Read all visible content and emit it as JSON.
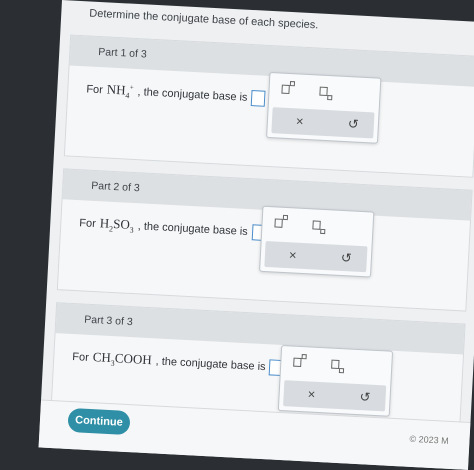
{
  "prompt": "Determine the conjugate base of each species.",
  "parts": [
    {
      "header": "Part 1 of 3",
      "pre": "For ",
      "species_main": "NH",
      "species_sub": "4",
      "species_sup": "+",
      "species_tail": "",
      "post": ", the conjugate base is",
      "end": "."
    },
    {
      "header": "Part 2 of 3",
      "pre": "For ",
      "species_main": "H",
      "species_sub": "2",
      "species_sup": "",
      "species_tail": "SO",
      "species_sub2": "3",
      "post": ", the conjugate base is",
      "end": "."
    },
    {
      "header": "Part 3 of 3",
      "pre": "For ",
      "species_main": "CH",
      "species_sub": "3",
      "species_sup": "",
      "species_tail": "COOH",
      "species_sub2": "",
      "post": ", the conjugate base is",
      "end": "."
    }
  ],
  "palette": {
    "clear_symbol": "×",
    "undo_symbol": "↺"
  },
  "footer": {
    "continue_label": "Continue",
    "copyright": "© 2023 M"
  }
}
